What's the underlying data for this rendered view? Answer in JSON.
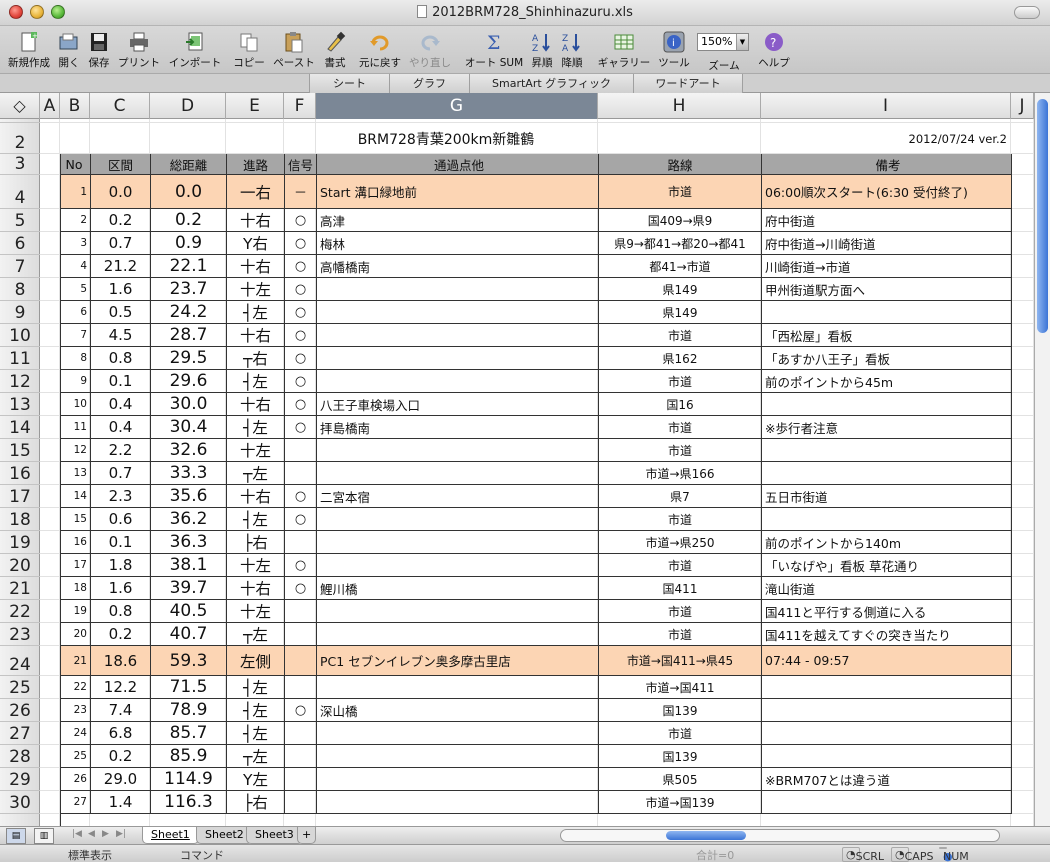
{
  "window": {
    "title": "2012BRM728_Shinhinazuru.xls"
  },
  "toolbar": {
    "new": "新規作成",
    "open": "開く",
    "save": "保存",
    "print": "プリント",
    "import": "インポート",
    "copy": "コピー",
    "paste": "ペースト",
    "format": "書式",
    "undo": "元に戻す",
    "redo": "やり直し",
    "autosum": "オート SUM",
    "sort_asc": "昇順",
    "sort_desc": "降順",
    "gallery": "ギャラリー",
    "tools": "ツール",
    "zoom_label": "ズーム",
    "zoom_value": "150%",
    "help": "ヘルプ"
  },
  "ribbon": {
    "tabs": [
      "シート",
      "グラフ",
      "SmartArt グラフィック",
      "ワードアート"
    ]
  },
  "columns": [
    "A",
    "B",
    "C",
    "D",
    "E",
    "F",
    "G",
    "H",
    "I",
    "J"
  ],
  "corner": "◇",
  "sheet": {
    "title": "BRM728青葉200km新雛鶴",
    "version": "2012/07/24 ver.2",
    "headers": {
      "no": "No",
      "section": "区間",
      "total": "総距離",
      "dir": "進路",
      "signal": "信号",
      "point": "通過点他",
      "route": "路線",
      "note": "備考"
    },
    "rows": [
      {
        "no": "1",
        "section": "0.0",
        "total": "0.0",
        "dir": "一右",
        "signal": "－",
        "point": "Start  溝口緑地前",
        "route": "市道",
        "note": "06:00順次スタート(6:30  受付終了)"
      },
      {
        "no": "2",
        "section": "0.2",
        "total": "0.2",
        "dir": "十右",
        "signal": "○",
        "point": "高津",
        "route": "国409→県9",
        "note": "府中街道"
      },
      {
        "no": "3",
        "section": "0.7",
        "total": "0.9",
        "dir": "Y右",
        "signal": "○",
        "point": "梅林",
        "route": "県9→都41→都20→都41",
        "note": "府中街道→川崎街道"
      },
      {
        "no": "4",
        "section": "21.2",
        "total": "22.1",
        "dir": "十右",
        "signal": "○",
        "point": "高幡橋南",
        "route": "都41→市道",
        "note": "川崎街道→市道"
      },
      {
        "no": "5",
        "section": "1.6",
        "total": "23.7",
        "dir": "十左",
        "signal": "○",
        "point": "",
        "route": "県149",
        "note": "甲州街道駅方面へ"
      },
      {
        "no": "6",
        "section": "0.5",
        "total": "24.2",
        "dir": "┤左",
        "signal": "○",
        "point": "",
        "route": "県149",
        "note": ""
      },
      {
        "no": "7",
        "section": "4.5",
        "total": "28.7",
        "dir": "十右",
        "signal": "○",
        "point": "",
        "route": "市道",
        "note": "「西松屋」看板"
      },
      {
        "no": "8",
        "section": "0.8",
        "total": "29.5",
        "dir": "┬右",
        "signal": "○",
        "point": "",
        "route": "県162",
        "note": "「あすか八王子」看板"
      },
      {
        "no": "9",
        "section": "0.1",
        "total": "29.6",
        "dir": "┤左",
        "signal": "○",
        "point": "",
        "route": "市道",
        "note": "前のポイントから45m"
      },
      {
        "no": "10",
        "section": "0.4",
        "total": "30.0",
        "dir": "十右",
        "signal": "○",
        "point": "八王子車検場入口",
        "route": "国16",
        "note": ""
      },
      {
        "no": "11",
        "section": "0.4",
        "total": "30.4",
        "dir": "┤左",
        "signal": "○",
        "point": "拝島橋南",
        "route": "市道",
        "note": "※歩行者注意"
      },
      {
        "no": "12",
        "section": "2.2",
        "total": "32.6",
        "dir": "十左",
        "signal": "",
        "point": "",
        "route": "市道",
        "note": ""
      },
      {
        "no": "13",
        "section": "0.7",
        "total": "33.3",
        "dir": "┬左",
        "signal": "",
        "point": "",
        "route": "市道→県166",
        "note": ""
      },
      {
        "no": "14",
        "section": "2.3",
        "total": "35.6",
        "dir": "十右",
        "signal": "○",
        "point": "二宮本宿",
        "route": "県7",
        "note": "五日市街道"
      },
      {
        "no": "15",
        "section": "0.6",
        "total": "36.2",
        "dir": "┤左",
        "signal": "○",
        "point": "",
        "route": "市道",
        "note": ""
      },
      {
        "no": "16",
        "section": "0.1",
        "total": "36.3",
        "dir": "├右",
        "signal": "",
        "point": "",
        "route": "市道→県250",
        "note": "前のポイントから140m"
      },
      {
        "no": "17",
        "section": "1.8",
        "total": "38.1",
        "dir": "十左",
        "signal": "○",
        "point": "",
        "route": "市道",
        "note": "「いなげや」看板  草花通り"
      },
      {
        "no": "18",
        "section": "1.6",
        "total": "39.7",
        "dir": "十右",
        "signal": "○",
        "point": "鯉川橋",
        "route": "国411",
        "note": "滝山街道"
      },
      {
        "no": "19",
        "section": "0.8",
        "total": "40.5",
        "dir": "十左",
        "signal": "",
        "point": "",
        "route": "市道",
        "note": "国411と平行する側道に入る"
      },
      {
        "no": "20",
        "section": "0.2",
        "total": "40.7",
        "dir": "┬左",
        "signal": "",
        "point": "",
        "route": "市道",
        "note": "国411を越えてすぐの突き当たり"
      },
      {
        "no": "21",
        "section": "18.6",
        "total": "59.3",
        "dir": "左側",
        "signal": "",
        "point": "PC1 セブンイレブン奥多摩古里店",
        "route": "市道→国411→県45",
        "note": "07:44 - 09:57"
      },
      {
        "no": "22",
        "section": "12.2",
        "total": "71.5",
        "dir": "┤左",
        "signal": "",
        "point": "",
        "route": "市道→国411",
        "note": ""
      },
      {
        "no": "23",
        "section": "7.4",
        "total": "78.9",
        "dir": "┤左",
        "signal": "○",
        "point": "深山橋",
        "route": "国139",
        "note": ""
      },
      {
        "no": "24",
        "section": "6.8",
        "total": "85.7",
        "dir": "┤左",
        "signal": "",
        "point": "",
        "route": "市道",
        "note": ""
      },
      {
        "no": "25",
        "section": "0.2",
        "total": "85.9",
        "dir": "┬左",
        "signal": "",
        "point": "",
        "route": "国139",
        "note": ""
      },
      {
        "no": "26",
        "section": "29.0",
        "total": "114.9",
        "dir": "Y左",
        "signal": "",
        "point": "",
        "route": "県505",
        "note": "※BRM707とは違う道"
      },
      {
        "no": "27",
        "section": "1.4",
        "total": "116.3",
        "dir": "├右",
        "signal": "",
        "point": "",
        "route": "市道→国139",
        "note": ""
      }
    ]
  },
  "sheet_tabs": [
    "Sheet1",
    "Sheet2",
    "Sheet3"
  ],
  "sheet_add": "+",
  "status": {
    "mode": "標準表示",
    "command": "コマンド",
    "sum": "合計=0",
    "scrl": "SCRL",
    "caps": "CAPS",
    "num": "NUM"
  },
  "colors": {
    "highlight": "#fcd5b4",
    "header": "#a6a6a6",
    "selected_col": "#7b8796",
    "scroll_thumb": "#3b74d6"
  }
}
